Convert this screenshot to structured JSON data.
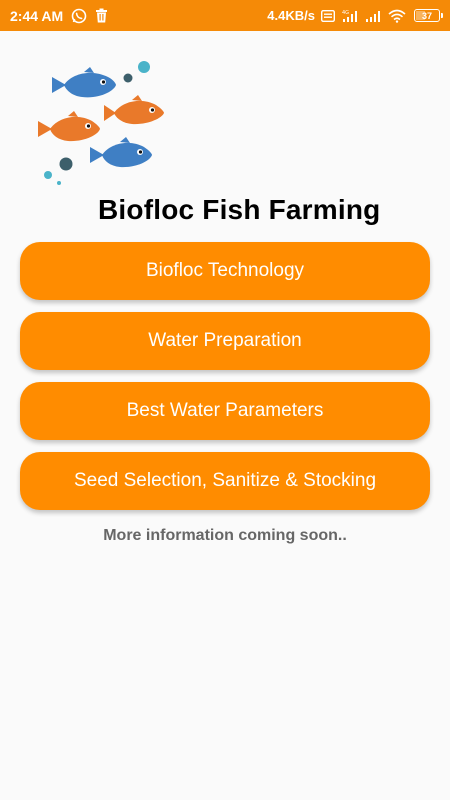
{
  "status_bar": {
    "time": "2:44 AM",
    "net_speed": "4.4KB/s",
    "battery": "37",
    "icons": [
      "whatsapp-icon",
      "trash-icon",
      "volte-icon",
      "signal-4g-icon",
      "signal-icon",
      "wifi-icon",
      "battery-icon"
    ]
  },
  "app": {
    "title": "Biofloc Fish Farming"
  },
  "menu": {
    "items": [
      {
        "label": "Biofloc Technology"
      },
      {
        "label": "Water Preparation"
      },
      {
        "label": "Best Water Parameters"
      },
      {
        "label": "Seed Selection, Sanitize & Stocking"
      }
    ]
  },
  "footer": {
    "note": "More information coming soon.."
  },
  "colors": {
    "status_bar": "#f58a07",
    "button": "#ff8c00",
    "background": "#fafafa",
    "fish_blue": "#3f7fc4",
    "fish_orange": "#e9792a",
    "bubble_teal": "#4ab3c9",
    "bubble_dark": "#3d5f6b"
  }
}
